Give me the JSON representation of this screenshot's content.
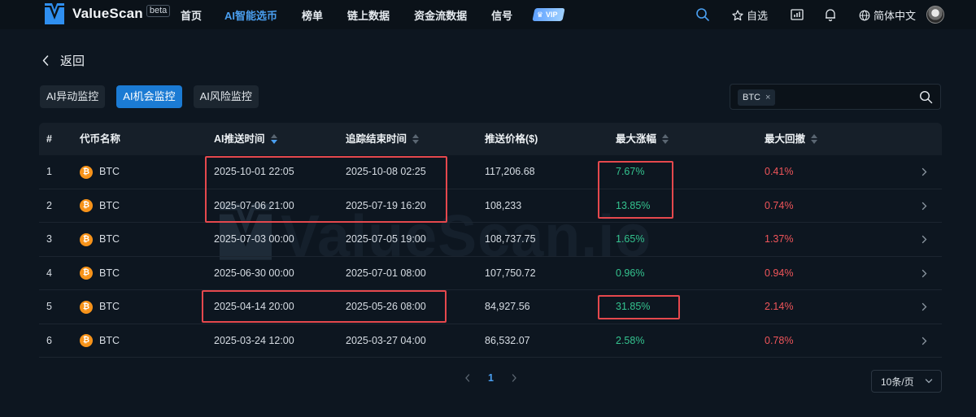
{
  "nav": {
    "brand": "ValueScan",
    "beta": "beta",
    "links": [
      "首页",
      "AI智能选币",
      "榜单",
      "链上数据",
      "资金流数据",
      "信号"
    ],
    "active_link": "AI智能选币",
    "vip": "VIP",
    "favorites": "自选",
    "language": "简体中文"
  },
  "back_label": "返回",
  "tabs": [
    "AI异动监控",
    "AI机会监控",
    "AI风险监控"
  ],
  "active_tab": "AI机会监控",
  "search": {
    "chip": "BTC",
    "chip_remove": "×"
  },
  "table": {
    "headers": {
      "index": "#",
      "coin": "代币名称",
      "push_time": "AI推送时间",
      "end_time": "追踪结束时间",
      "price": "推送价格($)",
      "max_gain": "最大涨幅",
      "max_drawdown": "最大回撤"
    },
    "rows": [
      {
        "index": "1",
        "coin": "BTC",
        "push_time": "2025-10-01 22:05",
        "end_time": "2025-10-08 02:25",
        "price": "117,206.68",
        "max_gain": "7.67%",
        "max_drawdown": "0.41%"
      },
      {
        "index": "2",
        "coin": "BTC",
        "push_time": "2025-07-06 21:00",
        "end_time": "2025-07-19 16:20",
        "price": "108,233",
        "max_gain": "13.85%",
        "max_drawdown": "0.74%"
      },
      {
        "index": "3",
        "coin": "BTC",
        "push_time": "2025-07-03 00:00",
        "end_time": "2025-07-05 19:00",
        "price": "108,737.75",
        "max_gain": "1.65%",
        "max_drawdown": "1.37%"
      },
      {
        "index": "4",
        "coin": "BTC",
        "push_time": "2025-06-30 00:00",
        "end_time": "2025-07-01 08:00",
        "price": "107,750.72",
        "max_gain": "0.96%",
        "max_drawdown": "0.94%"
      },
      {
        "index": "5",
        "coin": "BTC",
        "push_time": "2025-04-14 20:00",
        "end_time": "2025-05-26 08:00",
        "price": "84,927.56",
        "max_gain": "31.85%",
        "max_drawdown": "2.14%"
      },
      {
        "index": "6",
        "coin": "BTC",
        "push_time": "2025-03-24 12:00",
        "end_time": "2025-03-27 04:00",
        "price": "86,532.07",
        "max_gain": "2.58%",
        "max_drawdown": "0.78%"
      }
    ]
  },
  "watermark": "ValueScan.io",
  "pagination": {
    "current": "1",
    "page_size": "10条/页"
  },
  "colors": {
    "accent": "#1b7bd4",
    "gain": "#34c38f",
    "loss": "#f0555a",
    "highlight": "#e5484d"
  }
}
